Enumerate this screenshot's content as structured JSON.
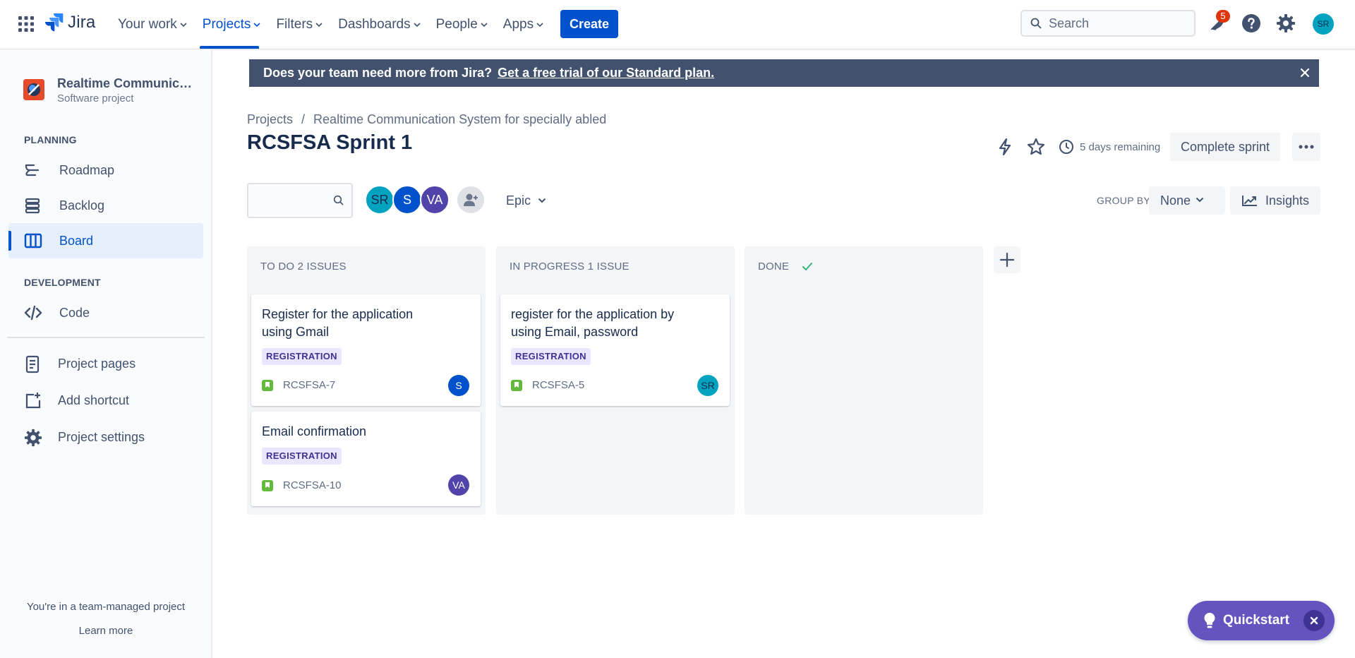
{
  "topnav": {
    "logo_text": "Jira",
    "items": [
      {
        "label": "Your work"
      },
      {
        "label": "Projects"
      },
      {
        "label": "Filters"
      },
      {
        "label": "Dashboards"
      },
      {
        "label": "People"
      },
      {
        "label": "Apps"
      }
    ],
    "active_item": "Projects",
    "create_label": "Create",
    "search_placeholder": "Search",
    "notification_count": "5",
    "user_initials": "SR"
  },
  "sidebar": {
    "project_name": "Realtime Communicati...",
    "project_type": "Software project",
    "planning_label": "PLANNING",
    "planning_items": [
      {
        "label": "Roadmap"
      },
      {
        "label": "Backlog"
      },
      {
        "label": "Board"
      }
    ],
    "selected_item": "Board",
    "development_label": "DEVELOPMENT",
    "development_items": [
      {
        "label": "Code"
      }
    ],
    "other_items": [
      {
        "label": "Project pages"
      },
      {
        "label": "Add shortcut"
      },
      {
        "label": "Project settings"
      }
    ],
    "footer_text": "You're in a team-managed project",
    "footer_link": "Learn more"
  },
  "banner": {
    "text": "Does your team need more from Jira?",
    "link": "Get a free trial of our Standard plan."
  },
  "header": {
    "breadcrumb": [
      "Projects",
      "/",
      "Realtime Communication System for specially abled"
    ],
    "title": "RCSFSA Sprint 1",
    "days_remaining": "5 days remaining",
    "complete_sprint_label": "Complete sprint"
  },
  "filters": {
    "search_value": "",
    "avatars": [
      {
        "initials": "SR",
        "color": "#00A3BF"
      },
      {
        "initials": "S",
        "color": "#0052CC"
      },
      {
        "initials": "VA",
        "color": "#5243AA"
      }
    ],
    "epic_label": "Epic",
    "group_by_label": "GROUP BY",
    "group_by_value": "None",
    "insights_label": "Insights"
  },
  "columns": [
    {
      "title": "TO DO 2 ISSUES",
      "cards": [
        {
          "title": "Register for the application using Gmail",
          "epic": "REGISTRATION",
          "key": "RCSFSA-7",
          "assignee": "S",
          "assignee_color": "#0052CC"
        },
        {
          "title": "Email confirmation",
          "epic": "REGISTRATION",
          "key": "RCSFSA-10",
          "assignee": "VA",
          "assignee_color": "#5243AA"
        }
      ]
    },
    {
      "title": "IN PROGRESS 1 ISSUE",
      "cards": [
        {
          "title": "register for the application by using Email, password",
          "epic": "REGISTRATION",
          "key": "RCSFSA-5",
          "assignee": "SR",
          "assignee_color": "#00A3BF"
        }
      ]
    },
    {
      "title": "DONE",
      "cards": []
    }
  ],
  "quickstart": {
    "label": "Quickstart"
  },
  "colors": {
    "brand": "#0052CC",
    "banner": "#42526E",
    "epic_bg": "#EAE6FF",
    "epic_text": "#403294",
    "quickstart": "#6554C0"
  }
}
